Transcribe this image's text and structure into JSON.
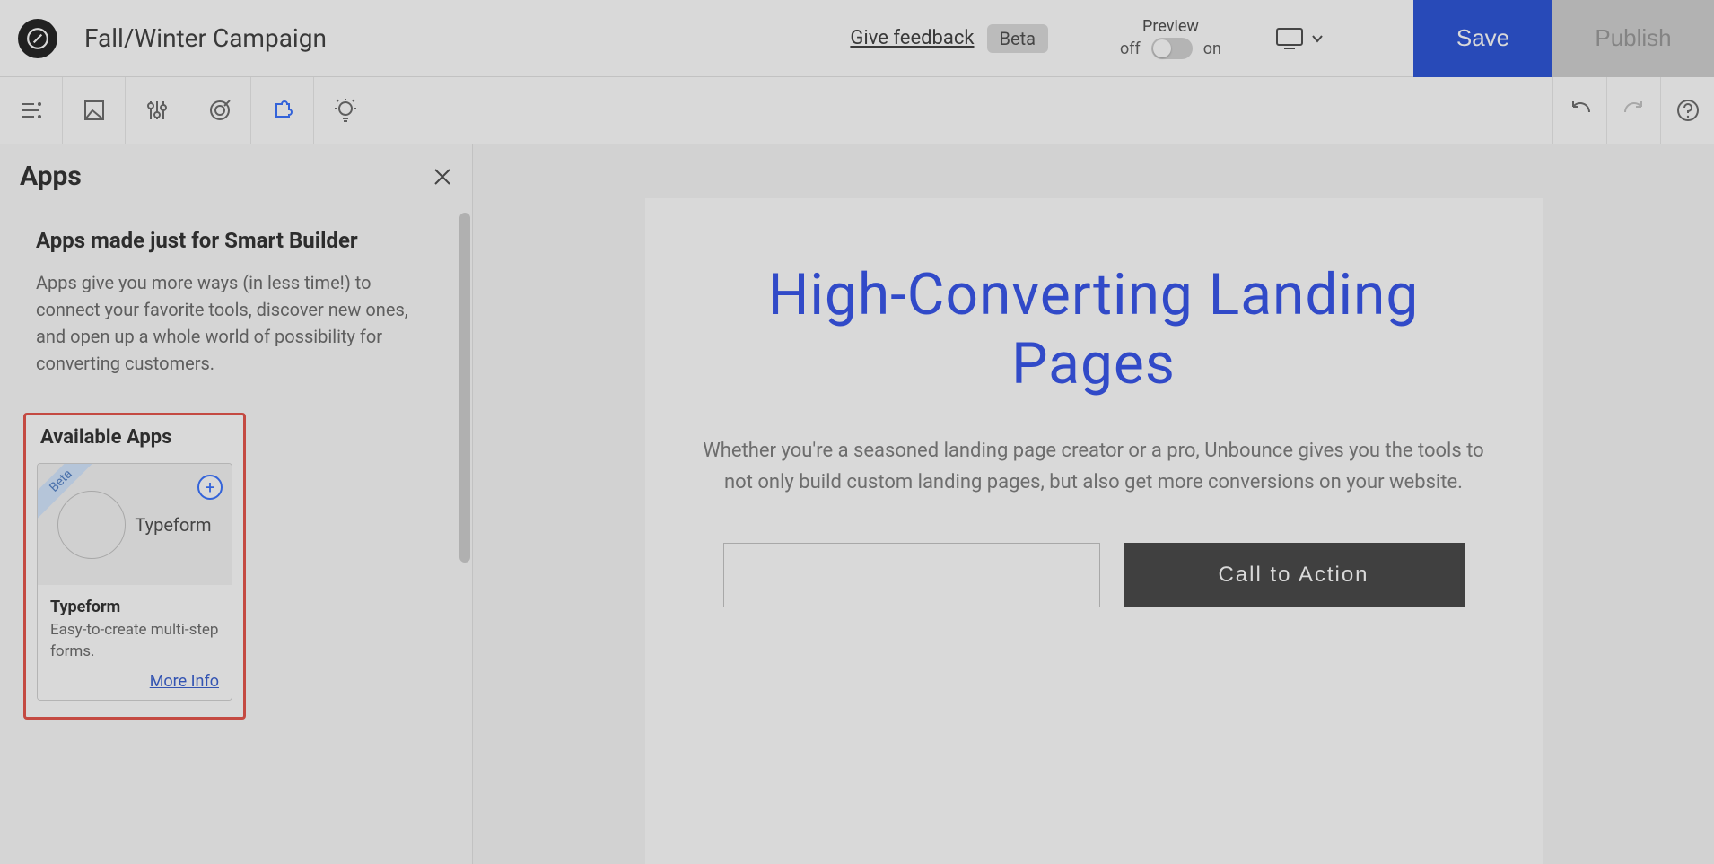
{
  "header": {
    "pageTitle": "Fall/Winter Campaign",
    "feedback": "Give feedback",
    "betaBadge": "Beta",
    "preview": {
      "label": "Preview",
      "off": "off",
      "on": "on"
    },
    "saveLabel": "Save",
    "publishLabel": "Publish"
  },
  "panel": {
    "title": "Apps",
    "subtitle": "Apps made just for Smart Builder",
    "description": "Apps give you more ways (in less time!) to connect your favorite tools, discover new ones, and open up a whole world of possibility for converting customers.",
    "availableTitle": "Available Apps",
    "card": {
      "ribbon": "Beta",
      "logoLabel": "Typeform",
      "name": "Typeform",
      "desc": "Easy-to-create multi-step forms.",
      "moreInfo": "More Info"
    }
  },
  "canvas": {
    "headline": "High-Converting Landing Pages",
    "subtext": "Whether you're a seasoned landing page creator or a pro, Unbounce gives you the tools to not only build custom landing pages, but also get more conversions on your website.",
    "cta": "Call to Action"
  }
}
